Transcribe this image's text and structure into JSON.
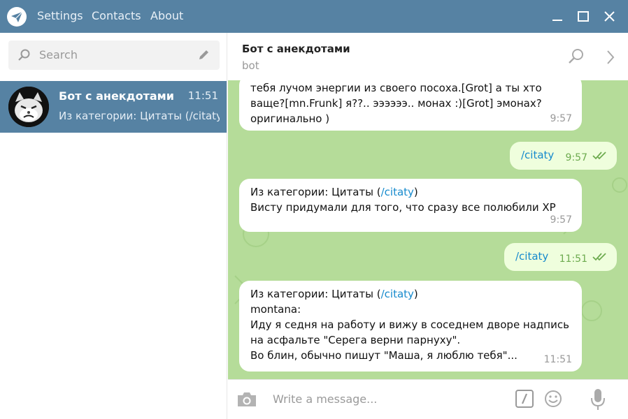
{
  "titlebar": {
    "menu": [
      "Settings",
      "Contacts",
      "About"
    ]
  },
  "sidebar": {
    "search_placeholder": "Search",
    "chats": [
      {
        "name": "Бот с анекдотами",
        "time": "11:51",
        "preview": "Из категории: Цитаты (/citaty)"
      }
    ]
  },
  "header": {
    "title": "Бот с анекдотами",
    "subtitle": "bot"
  },
  "messages": [
    {
      "dir": "in",
      "lines": [
        "тебя лучом энергии из своего посоха.[Grot] а ты хто",
        "ваще?[mn.Frunk] я??.. ээээээ.. монах :)[Grot] эмонах?",
        "оригинально )"
      ],
      "time": "9:57"
    },
    {
      "dir": "out",
      "text": "/citaty",
      "time": "9:57"
    },
    {
      "dir": "in",
      "prefix": "Из категории: Цитаты (",
      "link": "/citaty",
      "suffix": ")",
      "lines": [
        "Висту придумали для того, что сразу все полюбили XP"
      ],
      "time": "9:57"
    },
    {
      "dir": "out",
      "text": "/citaty",
      "time": "11:51"
    },
    {
      "dir": "in",
      "prefix": "Из категории: Цитаты (",
      "link": "/citaty",
      "suffix": ")",
      "lines": [
        "montana:",
        "Иду я седня на работу и вижу в соседнем дворе надпись",
        "на асфальте \"Серега верни парнуху\".",
        "Во блин, обычно пишут  \"Маша, я люблю тебя\"..."
      ],
      "time": "11:51"
    }
  ],
  "composer": {
    "placeholder": "Write a message..."
  },
  "colors": {
    "titlebar": "#5682a3",
    "chat_bg": "#b5dc99",
    "outgoing_bubble": "#effedd",
    "link": "#168acd"
  },
  "icons": [
    "telegram-logo-icon",
    "minimize-icon",
    "maximize-icon",
    "close-icon",
    "search-icon",
    "pencil-icon",
    "more-chevron-icon",
    "camera-icon",
    "bot-command-icon",
    "emoji-icon",
    "microphone-icon",
    "double-check-icon"
  ]
}
